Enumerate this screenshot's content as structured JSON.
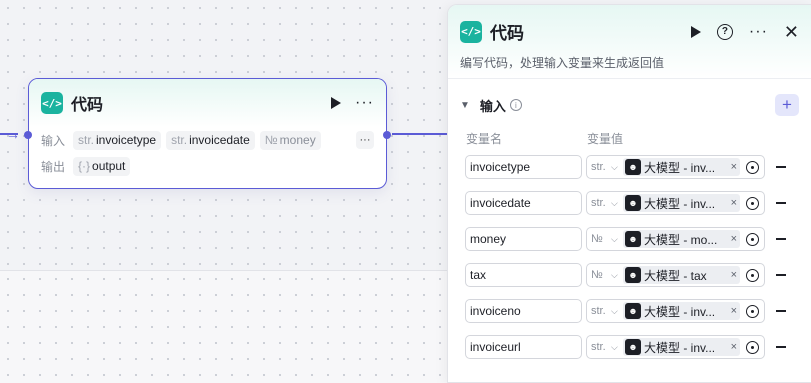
{
  "node": {
    "icon": "code-icon",
    "title": "代码",
    "input_label": "输入",
    "output_label": "输出",
    "inputs": [
      {
        "type": "str.",
        "name": "invoicetype"
      },
      {
        "type": "str.",
        "name": "invoicedate"
      },
      {
        "type": "№",
        "name": "money"
      }
    ],
    "more": "···",
    "outputs": [
      {
        "type": "{·}",
        "name": "output"
      }
    ]
  },
  "panel": {
    "title": "代码",
    "description": "编写代码，处理输入变量来生成返回值",
    "section_title": "输入",
    "col_name": "变量名",
    "col_value": "变量值",
    "rows": [
      {
        "name": "invoicetype",
        "type": "str.",
        "ref": "大模型 - inv...",
        "ref_icon": "bot-icon"
      },
      {
        "name": "invoicedate",
        "type": "str.",
        "ref": "大模型 - inv...",
        "ref_icon": "bot-icon"
      },
      {
        "name": "money",
        "type": "№",
        "ref": "大模型 - mo...",
        "ref_icon": "bot-icon"
      },
      {
        "name": "tax",
        "type": "№",
        "ref": "大模型 - tax",
        "ref_icon": "bot-icon"
      },
      {
        "name": "invoiceno",
        "type": "str.",
        "ref": "大模型 - inv...",
        "ref_icon": "bot-icon"
      },
      {
        "name": "invoiceurl",
        "type": "str.",
        "ref": "大模型 - inv...",
        "ref_icon": "bot-icon"
      }
    ]
  },
  "colors": {
    "accent": "#5b5bd6",
    "code_icon": "#1ab39f"
  }
}
